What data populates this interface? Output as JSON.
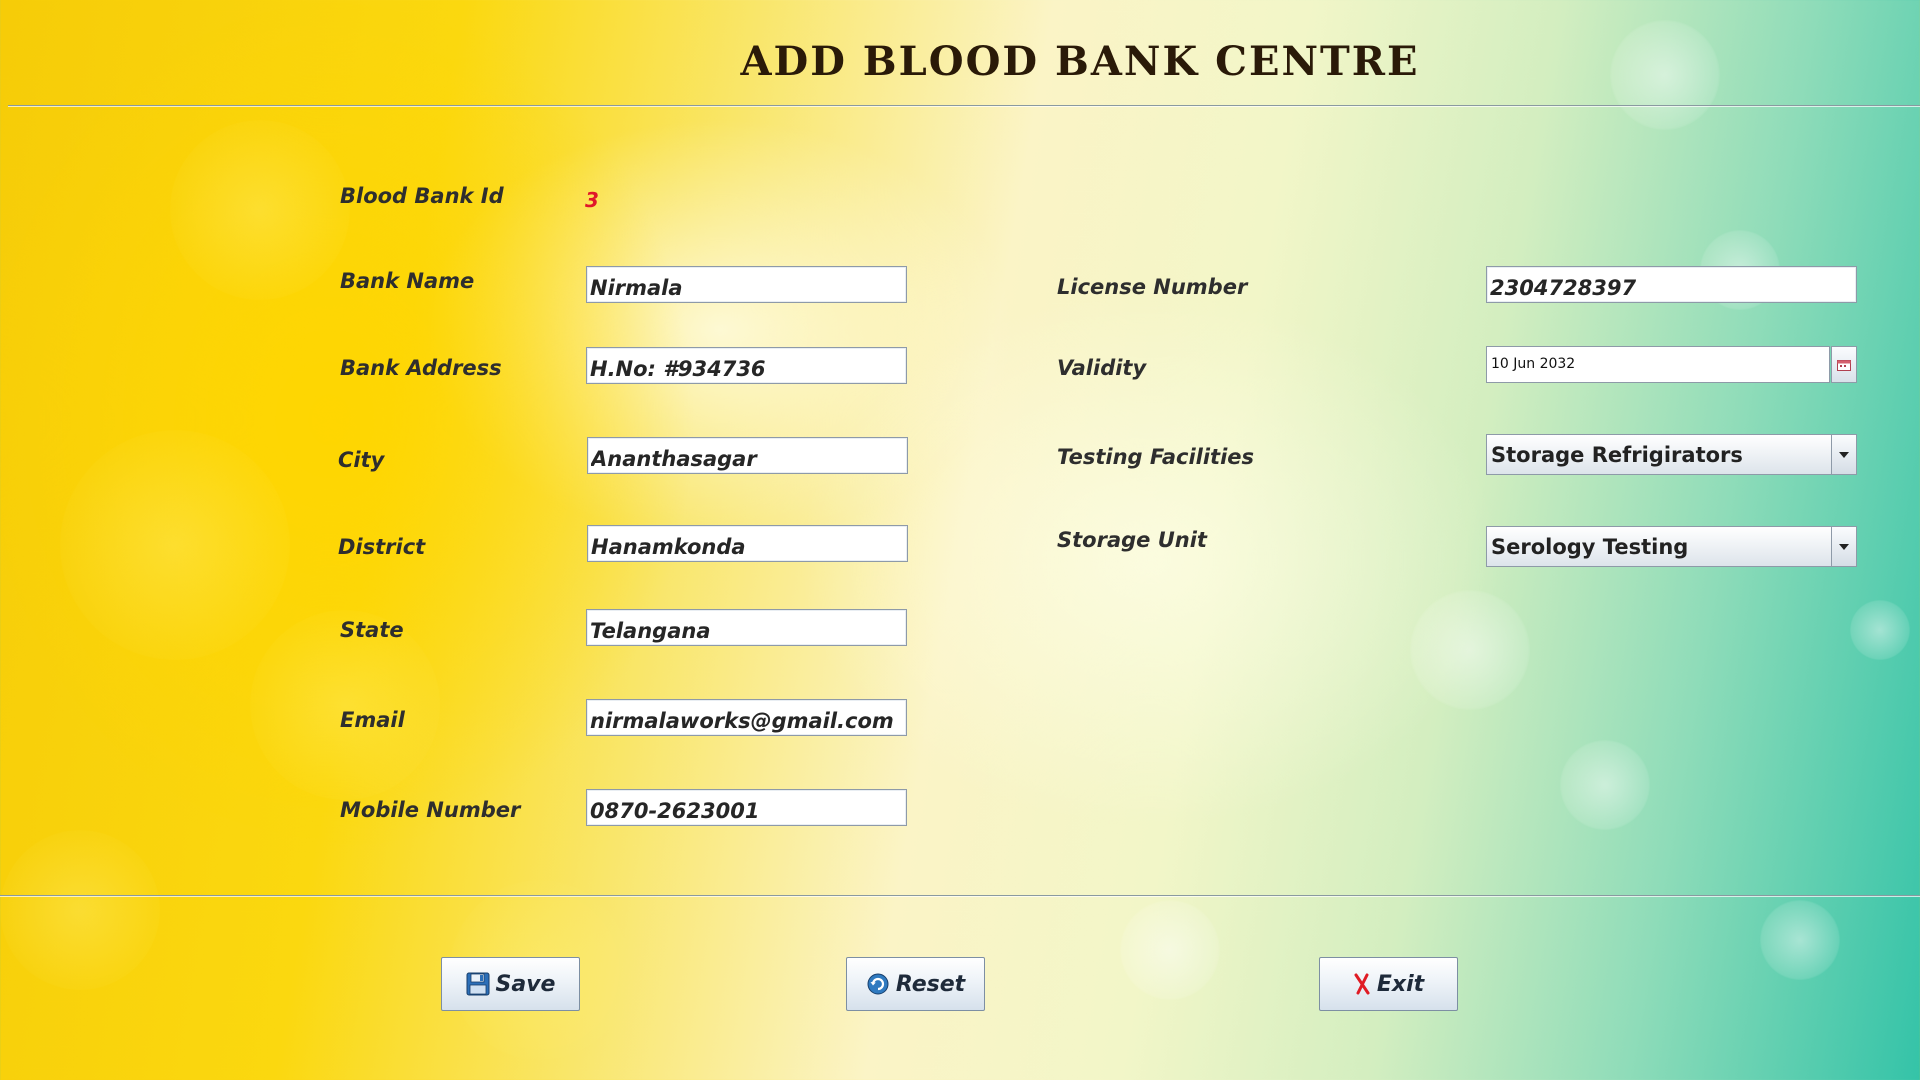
{
  "header": {
    "title": "ADD BLOOD BANK CENTRE"
  },
  "form": {
    "blood_bank_id": {
      "label": "Blood Bank Id",
      "value": "3"
    },
    "bank_name": {
      "label": "Bank Name",
      "value": "Nirmala"
    },
    "bank_address": {
      "label": "Bank Address",
      "value": "H.No: #934736"
    },
    "city": {
      "label": "City",
      "value": "Ananthasagar"
    },
    "district": {
      "label": "District",
      "value": "Hanamkonda"
    },
    "state": {
      "label": "State",
      "value": "Telangana"
    },
    "email": {
      "label": "Email",
      "value": "nirmalaworks@gmail.com"
    },
    "mobile": {
      "label": "Mobile Number",
      "value": "0870-2623001"
    },
    "license_number": {
      "label": "License Number",
      "value": "2304728397"
    },
    "validity": {
      "label": "Validity",
      "value": "10 Jun 2032"
    },
    "testing_facilities": {
      "label": "Testing Facilities",
      "value": "Storage Refrigirators"
    },
    "storage_unit": {
      "label": "Storage Unit",
      "value": "Serology Testing"
    }
  },
  "buttons": {
    "save": "Save",
    "reset": "Reset",
    "exit": "Exit"
  },
  "icons": {
    "save": "floppy-disk-icon",
    "reset": "refresh-icon",
    "exit": "red-x-icon",
    "calendar": "calendar-icon",
    "dropdown": "chevron-down-icon"
  },
  "colors": {
    "id_value": "#e0172a",
    "exit_icon": "#e01b24"
  }
}
